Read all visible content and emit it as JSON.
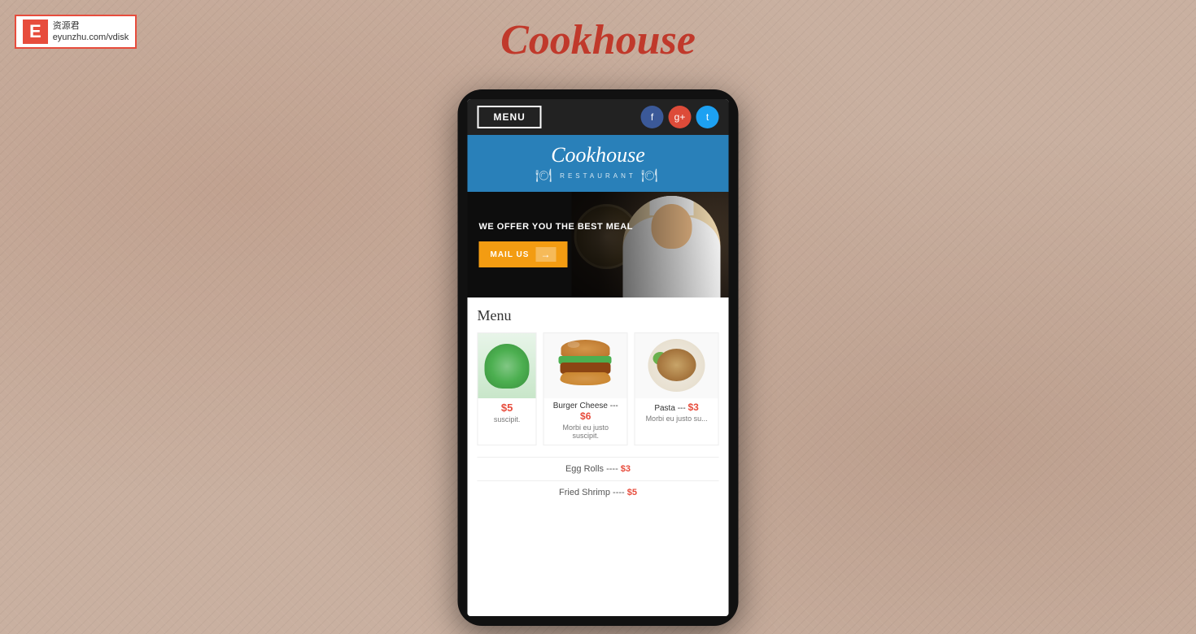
{
  "watermark": {
    "letter": "E",
    "site": "eyunzhu.com/vdisk",
    "label": "资源君"
  },
  "page": {
    "title": "Cookhouse"
  },
  "nav": {
    "menu_label": "MENU",
    "social": {
      "facebook": "f",
      "googleplus": "g+",
      "twitter": "t"
    }
  },
  "header": {
    "restaurant_name": "Cookhouse",
    "subtitle": "RESTAURANT"
  },
  "hero": {
    "tagline": "WE OFFER YOU THE BEST MEAL",
    "cta_label": "MAIL US",
    "cta_arrow": "→"
  },
  "menu": {
    "section_title": "Menu",
    "items": [
      {
        "name": "Burger Cheese",
        "separator": "---",
        "price": "$6",
        "description": "Morbi eu justo suscipit."
      },
      {
        "name": "Pasta",
        "separator": "---",
        "price": "$3",
        "description": "Morbi eu justo su..."
      }
    ],
    "list_items": [
      {
        "name": "Egg Rolls",
        "separator": "----",
        "price": "$3"
      },
      {
        "name": "Fried Shrimp",
        "separator": "----",
        "price": "$5"
      }
    ]
  }
}
